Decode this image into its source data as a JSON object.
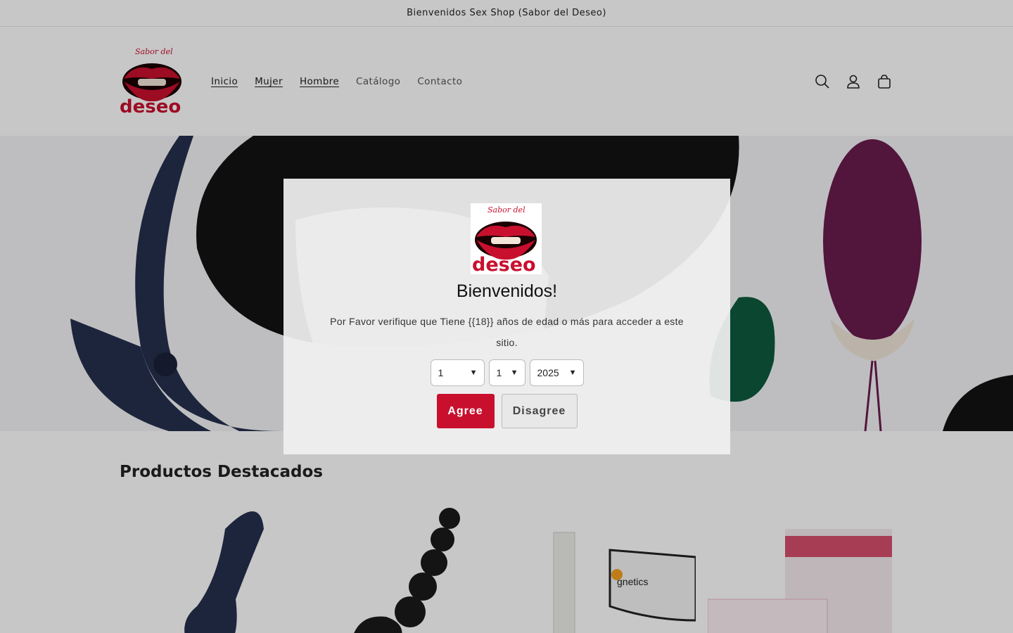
{
  "announcement": "Bienvenidos Sex Shop (Sabor del Deseo)",
  "logo": {
    "script_text": "Sabor del",
    "word": "deseo"
  },
  "nav": [
    "Inicio",
    "Mujer",
    "Hombre",
    "Catálogo",
    "Contacto"
  ],
  "header_icons": [
    "search-icon",
    "account-icon",
    "cart-icon"
  ],
  "featured_title": "Productos Destacados",
  "product_label": "gnetics",
  "modal": {
    "title": "Bienvenidos!",
    "text": "Por Favor verifique que Tiene {{18}} años de edad o más para acceder a este sitio.",
    "selects": [
      "1",
      "1",
      "2025"
    ],
    "agree": "Agree",
    "disagree": "Disagree"
  },
  "colors": {
    "accent": "#c8102e"
  }
}
